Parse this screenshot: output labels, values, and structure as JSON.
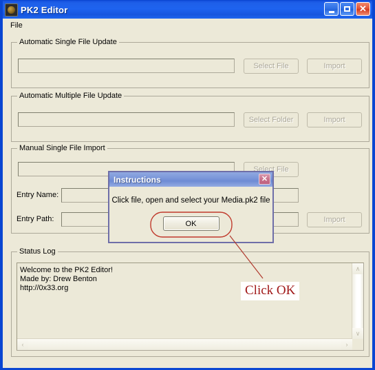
{
  "window": {
    "title": "PK2 Editor",
    "icon": "app-icon",
    "controls": {
      "minimize": "–",
      "maximize": "□",
      "close": "✕"
    }
  },
  "menubar": {
    "items": [
      {
        "label": "File"
      }
    ]
  },
  "groups": {
    "auto_single": {
      "title": "Automatic Single File Update",
      "path_value": "",
      "path_placeholder": "",
      "select_button": "Select File",
      "import_button": "Import",
      "disabled": true
    },
    "auto_multiple": {
      "title": "Automatic Multiple File Update",
      "path_value": "",
      "path_placeholder": "",
      "select_button": "Select Folder",
      "import_button": "Import",
      "disabled": true
    },
    "manual_single": {
      "title": "Manual Single File Import",
      "path_value": "",
      "select_button": "Select File",
      "import_button": "Import",
      "entry_name_label": "Entry Name:",
      "entry_name_value": "",
      "entry_path_label": "Entry Path:",
      "entry_path_value": "",
      "disabled": true
    },
    "status_log": {
      "title": "Status Log",
      "lines": [
        "Welcome to the PK2 Editor!",
        "Made by: Drew Benton",
        "http://0x33.org"
      ],
      "text": "Welcome to the PK2 Editor!\nMade by: Drew Benton\nhttp://0x33.org",
      "scroll_up_icon": "∧",
      "scroll_down_icon": "∨",
      "scroll_left_icon": "‹",
      "scroll_right_icon": "›"
    }
  },
  "dialog": {
    "title": "Instructions",
    "message": "Click file, open and select your Media.pk2 file",
    "ok_button": "OK",
    "close_icon": "✕"
  },
  "annotations": {
    "callout_text": "Click OK",
    "color": "#A01818",
    "ellipse_color": "#C0392B"
  },
  "colors": {
    "titlebar_blue": "#1E63EF",
    "window_border": "#0A46D2",
    "face": "#ECE9D8",
    "control_border": "#ACA899",
    "dialog_border": "#6E6EA8",
    "dialog_title": "#7C97DA",
    "annotation_red": "#A01818"
  }
}
